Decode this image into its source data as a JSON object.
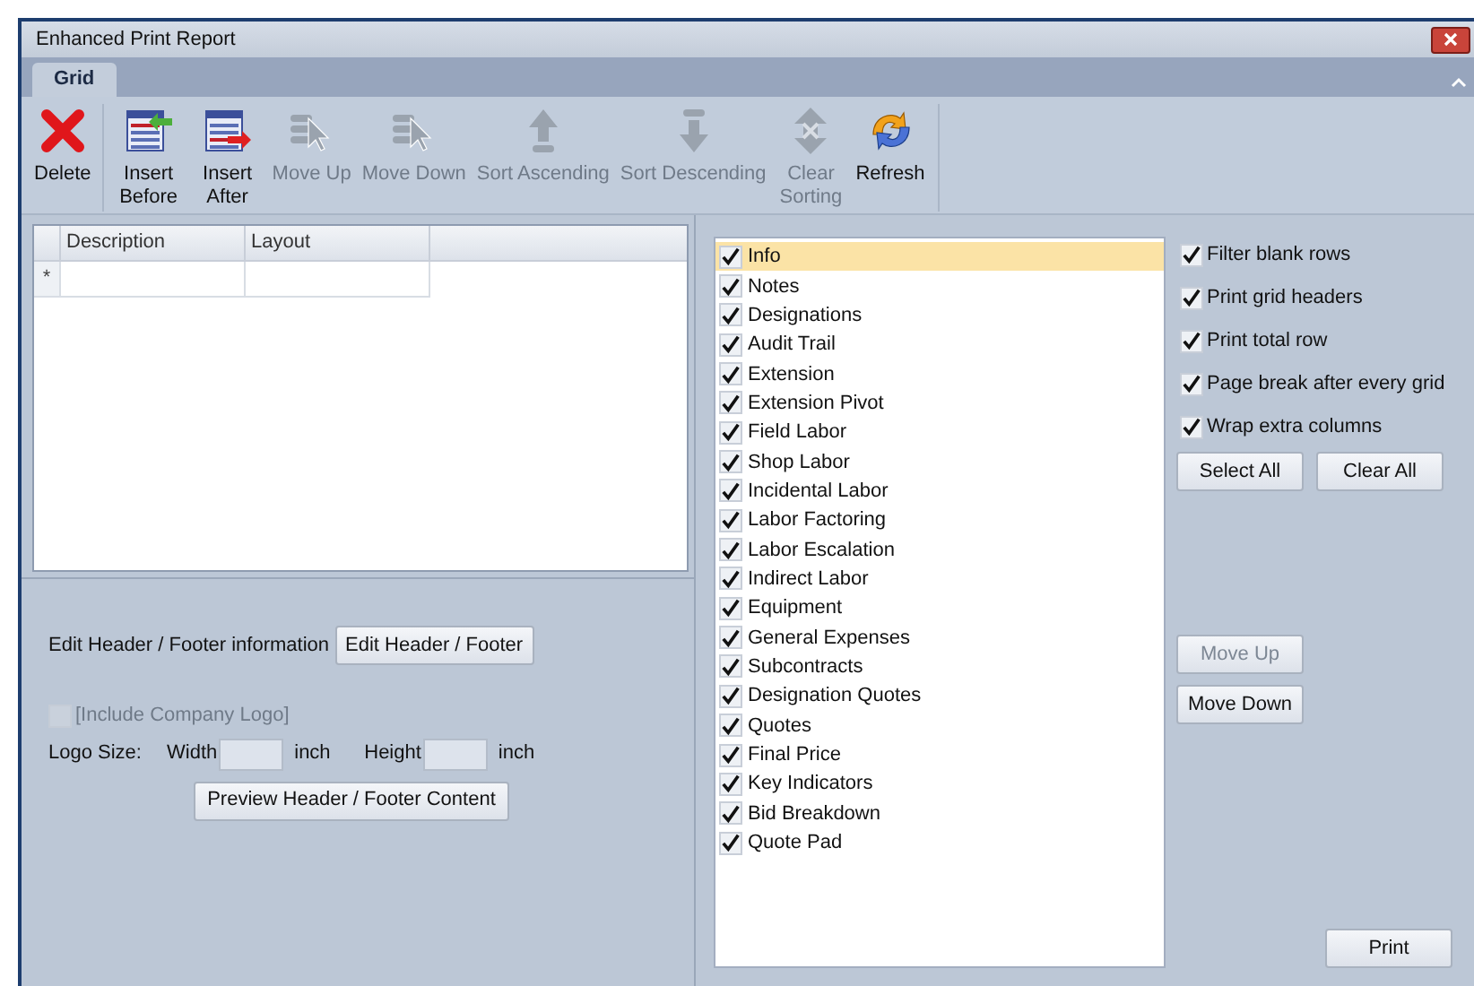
{
  "window": {
    "title": "Enhanced Print Report"
  },
  "tabs": [
    {
      "label": "Grid",
      "selected": true
    }
  ],
  "toolbar": [
    {
      "kind": "delete",
      "label": "Delete",
      "disabled": false
    },
    {
      "kind": "insert-before",
      "label": "Insert Before",
      "disabled": false
    },
    {
      "kind": "insert-after",
      "label": "Insert After",
      "disabled": false
    },
    {
      "kind": "move-up",
      "label": "Move Up",
      "disabled": true
    },
    {
      "kind": "move-down",
      "label": "Move Down",
      "disabled": true
    },
    {
      "kind": "sort-ascending",
      "label": "Sort Ascending",
      "disabled": true
    },
    {
      "kind": "sort-descending",
      "label": "Sort Descending",
      "disabled": true
    },
    {
      "kind": "clear-sorting",
      "label": "Clear Sorting",
      "disabled": true
    },
    {
      "kind": "refresh",
      "label": "Refresh",
      "disabled": false
    }
  ],
  "grid": {
    "columns": [
      "Description",
      "Layout"
    ],
    "new_row_marker": "*"
  },
  "header_footer": {
    "label": "Edit Header / Footer information",
    "edit_button": "Edit Header / Footer",
    "logo_checkbox": {
      "label": "[Include Company Logo]",
      "checked": false,
      "disabled": true
    },
    "logo_size_label": "Logo Size:",
    "width_label": "Width",
    "width_unit": "inch",
    "height_label": "Height",
    "height_unit": "inch",
    "preview_button": "Preview Header / Footer Content"
  },
  "sections": [
    {
      "label": "Info",
      "checked": true,
      "selected": true
    },
    {
      "label": "Notes",
      "checked": true,
      "selected": false
    },
    {
      "label": "Designations",
      "checked": true,
      "selected": false
    },
    {
      "label": "Audit Trail",
      "checked": true,
      "selected": false
    },
    {
      "label": "Extension",
      "checked": true,
      "selected": false
    },
    {
      "label": "Extension Pivot",
      "checked": true,
      "selected": false
    },
    {
      "label": "Field Labor",
      "checked": true,
      "selected": false
    },
    {
      "label": "Shop Labor",
      "checked": true,
      "selected": false
    },
    {
      "label": "Incidental Labor",
      "checked": true,
      "selected": false
    },
    {
      "label": "Labor Factoring",
      "checked": true,
      "selected": false
    },
    {
      "label": "Labor Escalation",
      "checked": true,
      "selected": false
    },
    {
      "label": "Indirect Labor",
      "checked": true,
      "selected": false
    },
    {
      "label": "Equipment",
      "checked": true,
      "selected": false
    },
    {
      "label": "General Expenses",
      "checked": true,
      "selected": false
    },
    {
      "label": "Subcontracts",
      "checked": true,
      "selected": false
    },
    {
      "label": "Designation Quotes",
      "checked": true,
      "selected": false
    },
    {
      "label": "Quotes",
      "checked": true,
      "selected": false
    },
    {
      "label": "Final Price",
      "checked": true,
      "selected": false
    },
    {
      "label": "Key Indicators",
      "checked": true,
      "selected": false
    },
    {
      "label": "Bid Breakdown",
      "checked": true,
      "selected": false
    },
    {
      "label": "Quote Pad",
      "checked": true,
      "selected": false
    }
  ],
  "options": [
    {
      "label": "Filter blank rows",
      "checked": true
    },
    {
      "label": "Print grid headers",
      "checked": true
    },
    {
      "label": "Print total row",
      "checked": true
    },
    {
      "label": "Page break after every grid",
      "checked": true
    },
    {
      "label": "Wrap extra columns",
      "checked": true
    }
  ],
  "select_all_button": {
    "label": "Select All",
    "disabled": false
  },
  "clear_all_button": {
    "label": "Clear All",
    "disabled": false
  },
  "move_up_button": {
    "label": "Move Up",
    "disabled": true
  },
  "move_down_button": {
    "label": "Move Down",
    "disabled": false
  },
  "print_button": {
    "label": "Print",
    "disabled": false
  }
}
